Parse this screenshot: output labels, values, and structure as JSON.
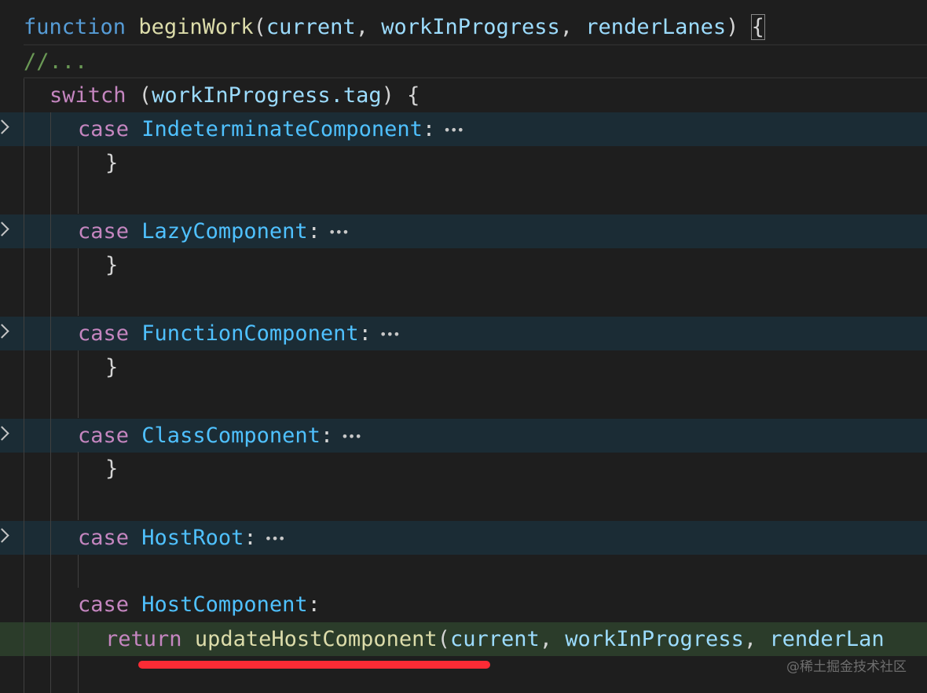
{
  "editor": {
    "lines": {
      "l1": {
        "kw": "function",
        "name": "beginWork",
        "open": "(",
        "p1": "current",
        "sep1": ", ",
        "p2": "workInProgress",
        "sep2": ", ",
        "p3": "renderLanes",
        "close": ") ",
        "brace": "{"
      },
      "l2": {
        "comment": "//..."
      },
      "l3": {
        "kw": "switch",
        "open": " (",
        "obj": "workInProgress",
        "prop": ".tag",
        "close": ") {"
      },
      "case1": {
        "kw": "case",
        "label": "IndeterminateComponent",
        "colon": ":"
      },
      "case2": {
        "kw": "case",
        "label": "LazyComponent",
        "colon": ":"
      },
      "case3": {
        "kw": "case",
        "label": "FunctionComponent",
        "colon": ":"
      },
      "case4": {
        "kw": "case",
        "label": "ClassComponent",
        "colon": ":"
      },
      "case5": {
        "kw": "case",
        "label": "HostRoot",
        "colon": ":"
      },
      "case6": {
        "kw": "case",
        "label": "HostComponent",
        "colon": ":"
      },
      "closing_brace": "}",
      "ret": {
        "kw": "return",
        "fn": "updateHostComponent",
        "open": "(",
        "p1": "current",
        "sep1": ", ",
        "p2": "workInProgress",
        "sep2": ", ",
        "p3": "renderLan"
      }
    },
    "fold_ellipsis": "•••"
  },
  "watermark": "@稀土掘金技术社区",
  "colors": {
    "background": "#1e1e1e",
    "folded_line_highlight": "#1b2c35",
    "current_line_highlight": "#2b3c2a",
    "annotation_underline": "#fc2b35"
  }
}
